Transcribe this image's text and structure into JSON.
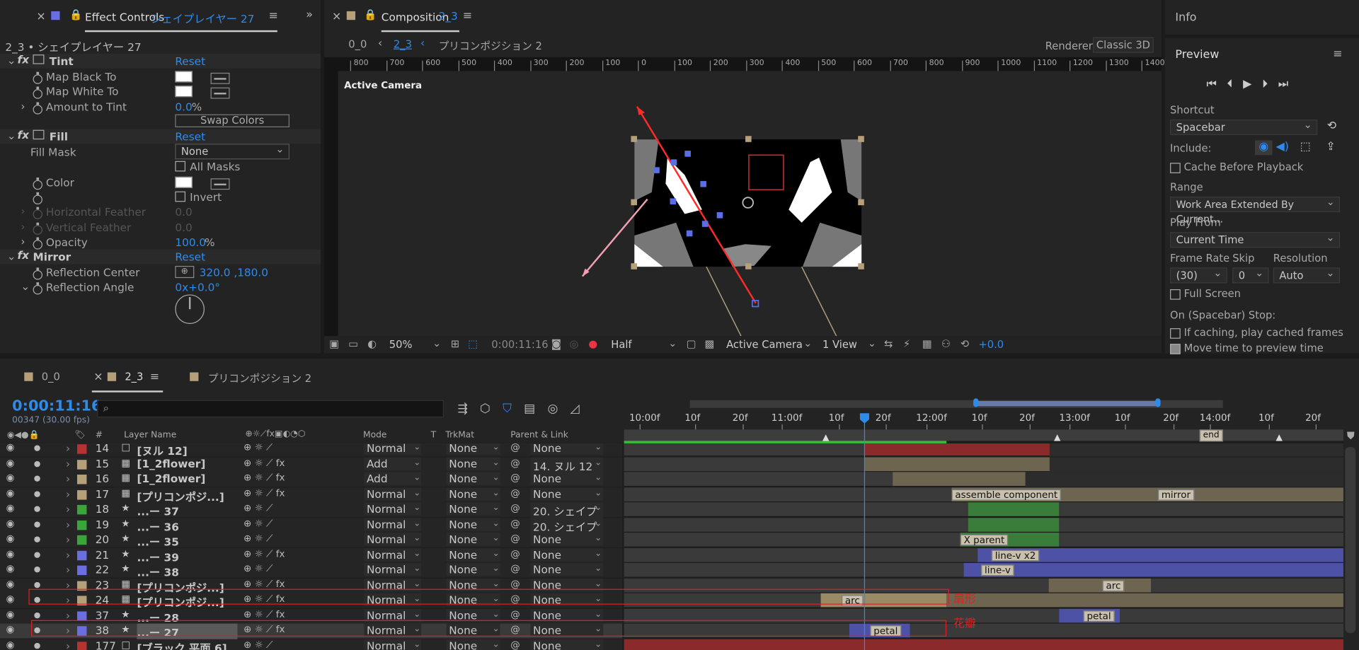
{
  "effect_panel": {
    "tab_title": "Effect Controls",
    "tab_layer": "シェイプレイヤー 27",
    "layer_path": "2_3 • シェイプレイヤー 27",
    "reset": "Reset",
    "fx": "fx",
    "tint": {
      "name": "Tint",
      "map_black": "Map Black To",
      "map_white": "Map White To",
      "amount_label": "Amount to Tint",
      "amount_value": "0.0",
      "amount_unit": "%",
      "swap": "Swap Colors"
    },
    "fill": {
      "name": "Fill",
      "mask_label": "Fill Mask",
      "mask_value": "None",
      "all_masks": "All Masks",
      "color": "Color",
      "invert": "Invert",
      "h_feather": "Horizontal Feather",
      "h_feather_value": "0.0",
      "v_feather": "Vertical Feather",
      "v_feather_value": "0.0",
      "opacity": "Opacity",
      "opacity_value": "100.0",
      "opacity_unit": "%"
    },
    "mirror": {
      "name": "Mirror",
      "center_label": "Reflection Center",
      "center_value": "320.0 ,180.0",
      "angle_label": "Reflection Angle",
      "angle_value": "0x+0.0°"
    }
  },
  "comp_panel": {
    "tab_title": "Composition",
    "tab_name": "2_3",
    "crumb1": "0_0",
    "crumb2": "2_3",
    "crumb3": "プリコンポジション 2",
    "renderer_label": "Renderer:",
    "renderer_value": "Classic 3D",
    "view_label": "Active Camera",
    "ruler": [
      "800",
      "700",
      "600",
      "500",
      "400",
      "300",
      "200",
      "100",
      "0",
      "100",
      "200",
      "300",
      "400",
      "500",
      "600",
      "700",
      "800",
      "900",
      "1000",
      "1100",
      "1200",
      "1300",
      "1400"
    ],
    "zoom": "50%",
    "timecode": "0:00:11:16",
    "resolution": "Half",
    "camera": "Active Camera",
    "views": "1 View",
    "exposure": "+0.0"
  },
  "right_panel": {
    "info": "Info",
    "preview": "Preview",
    "shortcut_label": "Shortcut",
    "shortcut_value": "Spacebar",
    "include": "Include:",
    "cache": "Cache Before Playback",
    "range_label": "Range",
    "range_value": "Work Area Extended By Current...",
    "play_from_label": "Play From",
    "play_from_value": "Current Time",
    "frame_rate_label": "Frame Rate",
    "frame_rate_value": "(30)",
    "skip_label": "Skip",
    "skip_value": "0",
    "resolution_label": "Resolution",
    "resolution_value": "Auto",
    "full_screen": "Full Screen",
    "stop_label": "On (Spacebar) Stop:",
    "if_caching": "If caching, play cached frames",
    "move_time": "Move time to preview time"
  },
  "timeline": {
    "tabs": [
      "0_0",
      "2_3",
      "プリコンポジション 2"
    ],
    "timecode": "0:00:11:16",
    "frame_info": "00347 (30.00 fps)",
    "search_placeholder": "",
    "col_num": "#",
    "col_name": "Layer Name",
    "col_mode": "Mode",
    "col_t": "T",
    "col_trkmat": "TrkMat",
    "col_parent": "Parent & Link",
    "ruler": [
      "10:00f",
      "10f",
      "20f",
      "11:00f",
      "10f",
      "20f",
      "12:00f",
      "10f",
      "20f",
      "13:00f",
      "10f",
      "20f",
      "14:00f",
      "10f",
      "20f"
    ],
    "end_marker": "end",
    "layers": [
      {
        "num": "14",
        "name": "[ヌル 12]",
        "mode": "Normal",
        "trk": "None",
        "parent": "None",
        "color": "#b83232",
        "icon": "null"
      },
      {
        "num": "15",
        "name": "[1_2flower]",
        "mode": "Add",
        "trk": "None",
        "parent": "14. ヌル 12",
        "color": "#b6a07a",
        "icon": "comp"
      },
      {
        "num": "16",
        "name": "[1_2flower]",
        "mode": "Add",
        "trk": "None",
        "parent": "None",
        "color": "#b6a07a",
        "icon": "comp"
      },
      {
        "num": "17",
        "name": "[プリコンポジ...]",
        "mode": "Normal",
        "trk": "None",
        "parent": "None",
        "color": "#b6a07a",
        "icon": "comp"
      },
      {
        "num": "18",
        "name": "...ー 37",
        "mode": "Normal",
        "trk": "None",
        "parent": "20. シェイプ",
        "color": "#3aa63a",
        "icon": "star"
      },
      {
        "num": "19",
        "name": "...ー 36",
        "mode": "Normal",
        "trk": "None",
        "parent": "20. シェイプ",
        "color": "#3aa63a",
        "icon": "star"
      },
      {
        "num": "20",
        "name": "...ー 35",
        "mode": "Normal",
        "trk": "None",
        "parent": "None",
        "color": "#3aa63a",
        "icon": "star"
      },
      {
        "num": "21",
        "name": "...ー 39",
        "mode": "Normal",
        "trk": "None",
        "parent": "None",
        "color": "#6a6ee0",
        "icon": "star"
      },
      {
        "num": "22",
        "name": "...ー 38",
        "mode": "Normal",
        "trk": "None",
        "parent": "None",
        "color": "#6a6ee0",
        "icon": "star"
      },
      {
        "num": "23",
        "name": "[プリコンポジ...]",
        "mode": "Normal",
        "trk": "None",
        "parent": "None",
        "color": "#b6a07a",
        "icon": "comp"
      },
      {
        "num": "24",
        "name": "[プリコンポジ...]",
        "mode": "Normal",
        "trk": "None",
        "parent": "None",
        "color": "#b6a07a",
        "icon": "comp"
      },
      {
        "num": "37",
        "name": "...ー 28",
        "mode": "Normal",
        "trk": "None",
        "parent": "None",
        "color": "#6a6ee0",
        "icon": "star"
      },
      {
        "num": "38",
        "name": "...ー 27",
        "mode": "Normal",
        "trk": "None",
        "parent": "None",
        "color": "#6a6ee0",
        "icon": "star"
      },
      {
        "num": "177",
        "name": "[ブラック 平面 6]",
        "mode": "Normal",
        "trk": "None",
        "parent": "None",
        "color": "#b83232",
        "icon": "solid"
      }
    ],
    "markers": {
      "assemble": "assemble component",
      "mirror": "mirror",
      "xparent": "X parent",
      "linev2": "line-v x2",
      "linev": "line-v",
      "arc1": "arc",
      "arc2": "arc",
      "petal1": "petal",
      "petal2": "petal"
    },
    "annotations": {
      "fan": "扇形",
      "petal": "花瓣"
    }
  },
  "colors": {
    "accent": "#2d8ceb",
    "panel": "#232323",
    "bg": "#1b1b1b",
    "annotation": "#e02020"
  }
}
